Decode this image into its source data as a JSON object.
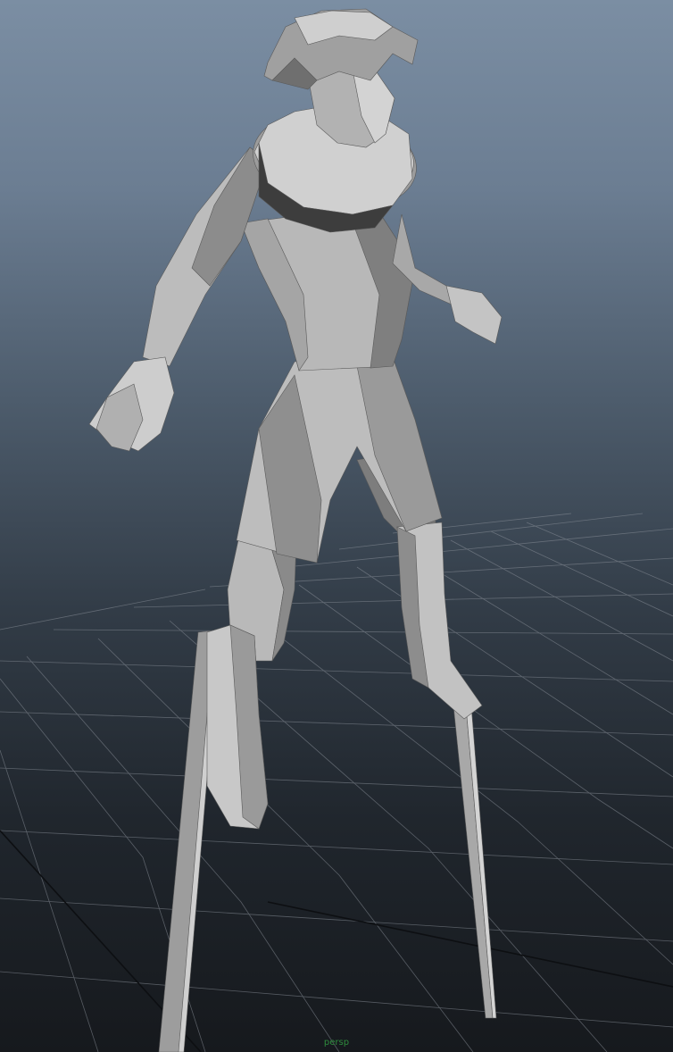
{
  "viewport": {
    "camera_name": "persp"
  }
}
